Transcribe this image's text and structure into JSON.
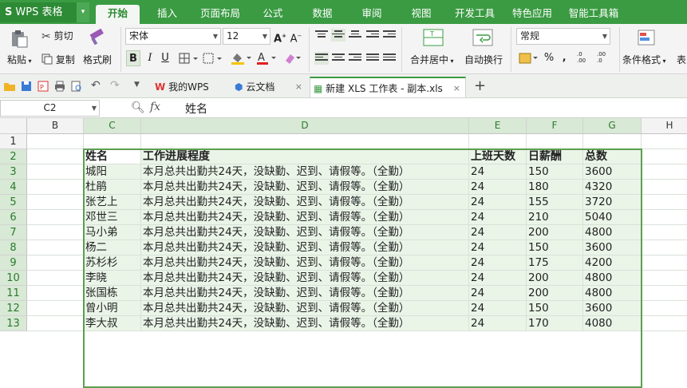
{
  "app": {
    "name": "WPS 表格",
    "menu_tabs": [
      "开始",
      "插入",
      "页面布局",
      "公式",
      "数据",
      "审阅",
      "视图",
      "开发工具",
      "特色应用",
      "智能工具箱"
    ],
    "active_tab": "开始"
  },
  "ribbon": {
    "paste": "粘贴",
    "cut": "剪切",
    "copy": "复制",
    "format_painter": "格式刷",
    "font_name": "宋体",
    "font_size": "12",
    "bold": "B",
    "italic": "I",
    "underline": "U",
    "merge_center": "合并居中",
    "wrap_text": "自动换行",
    "number_format": "常规",
    "percent": "%",
    "comma": "‚",
    "inc_decimal": ".0\n.00",
    "dec_decimal": ".00\n.0",
    "conditional_format": "条件格式",
    "table_style_partial": "表"
  },
  "doc_tabs": [
    {
      "label": "我的WPS",
      "close": "×"
    },
    {
      "label": "云文档",
      "close": "×"
    },
    {
      "label": "新建 XLS 工作表 - 副本.xls",
      "close": "×"
    }
  ],
  "add_tab": "+",
  "formula_bar": {
    "cell_ref": "C2",
    "fx": "fx",
    "content": "姓名"
  },
  "columns": [
    "B",
    "C",
    "D",
    "E",
    "F",
    "G",
    "H"
  ],
  "rows": [
    "1",
    "2",
    "3",
    "4",
    "5",
    "6",
    "7",
    "8",
    "9",
    "10",
    "11",
    "12",
    "13"
  ],
  "table": {
    "headers": [
      "姓名",
      "工作进展程度",
      "上班天数",
      "日薪酬",
      "总数"
    ],
    "records": [
      [
        "城阳",
        "本月总共出勤共24天，没缺勤、迟到、请假等。（全勤）",
        "24",
        "150",
        "3600"
      ],
      [
        "杜鹃",
        "本月总共出勤共24天，没缺勤、迟到、请假等。（全勤）",
        "24",
        "180",
        "4320"
      ],
      [
        "张艺上",
        "本月总共出勤共24天，没缺勤、迟到、请假等。（全勤）",
        "24",
        "155",
        "3720"
      ],
      [
        "邓世三",
        "本月总共出勤共24天，没缺勤、迟到、请假等。（全勤）",
        "24",
        "210",
        "5040"
      ],
      [
        "马小弟",
        "本月总共出勤共24天，没缺勤、迟到、请假等。（全勤）",
        "24",
        "200",
        "4800"
      ],
      [
        "杨二",
        "本月总共出勤共24天，没缺勤、迟到、请假等。（全勤）",
        "24",
        "150",
        "3600"
      ],
      [
        "苏杉杉",
        "本月总共出勤共24天，没缺勤、迟到、请假等。（全勤）",
        "24",
        "175",
        "4200"
      ],
      [
        "李晓",
        "本月总共出勤共24天，没缺勤、迟到、请假等。（全勤）",
        "24",
        "200",
        "4800"
      ],
      [
        "张国栋",
        "本月总共出勤共24天，没缺勤、迟到、请假等。（全勤）",
        "24",
        "200",
        "4800"
      ],
      [
        "曾小明",
        "本月总共出勤共24天，没缺勤、迟到、请假等。（全勤）",
        "24",
        "150",
        "3600"
      ],
      [
        "李大叔",
        "本月总共出勤共24天，没缺勤、迟到、请假等。（全勤）",
        "24",
        "170",
        "4080"
      ]
    ]
  },
  "colors": {
    "accent": "#3a9b42",
    "selection_fill": "#eaf5e8",
    "selection_border": "#5c9e50"
  }
}
